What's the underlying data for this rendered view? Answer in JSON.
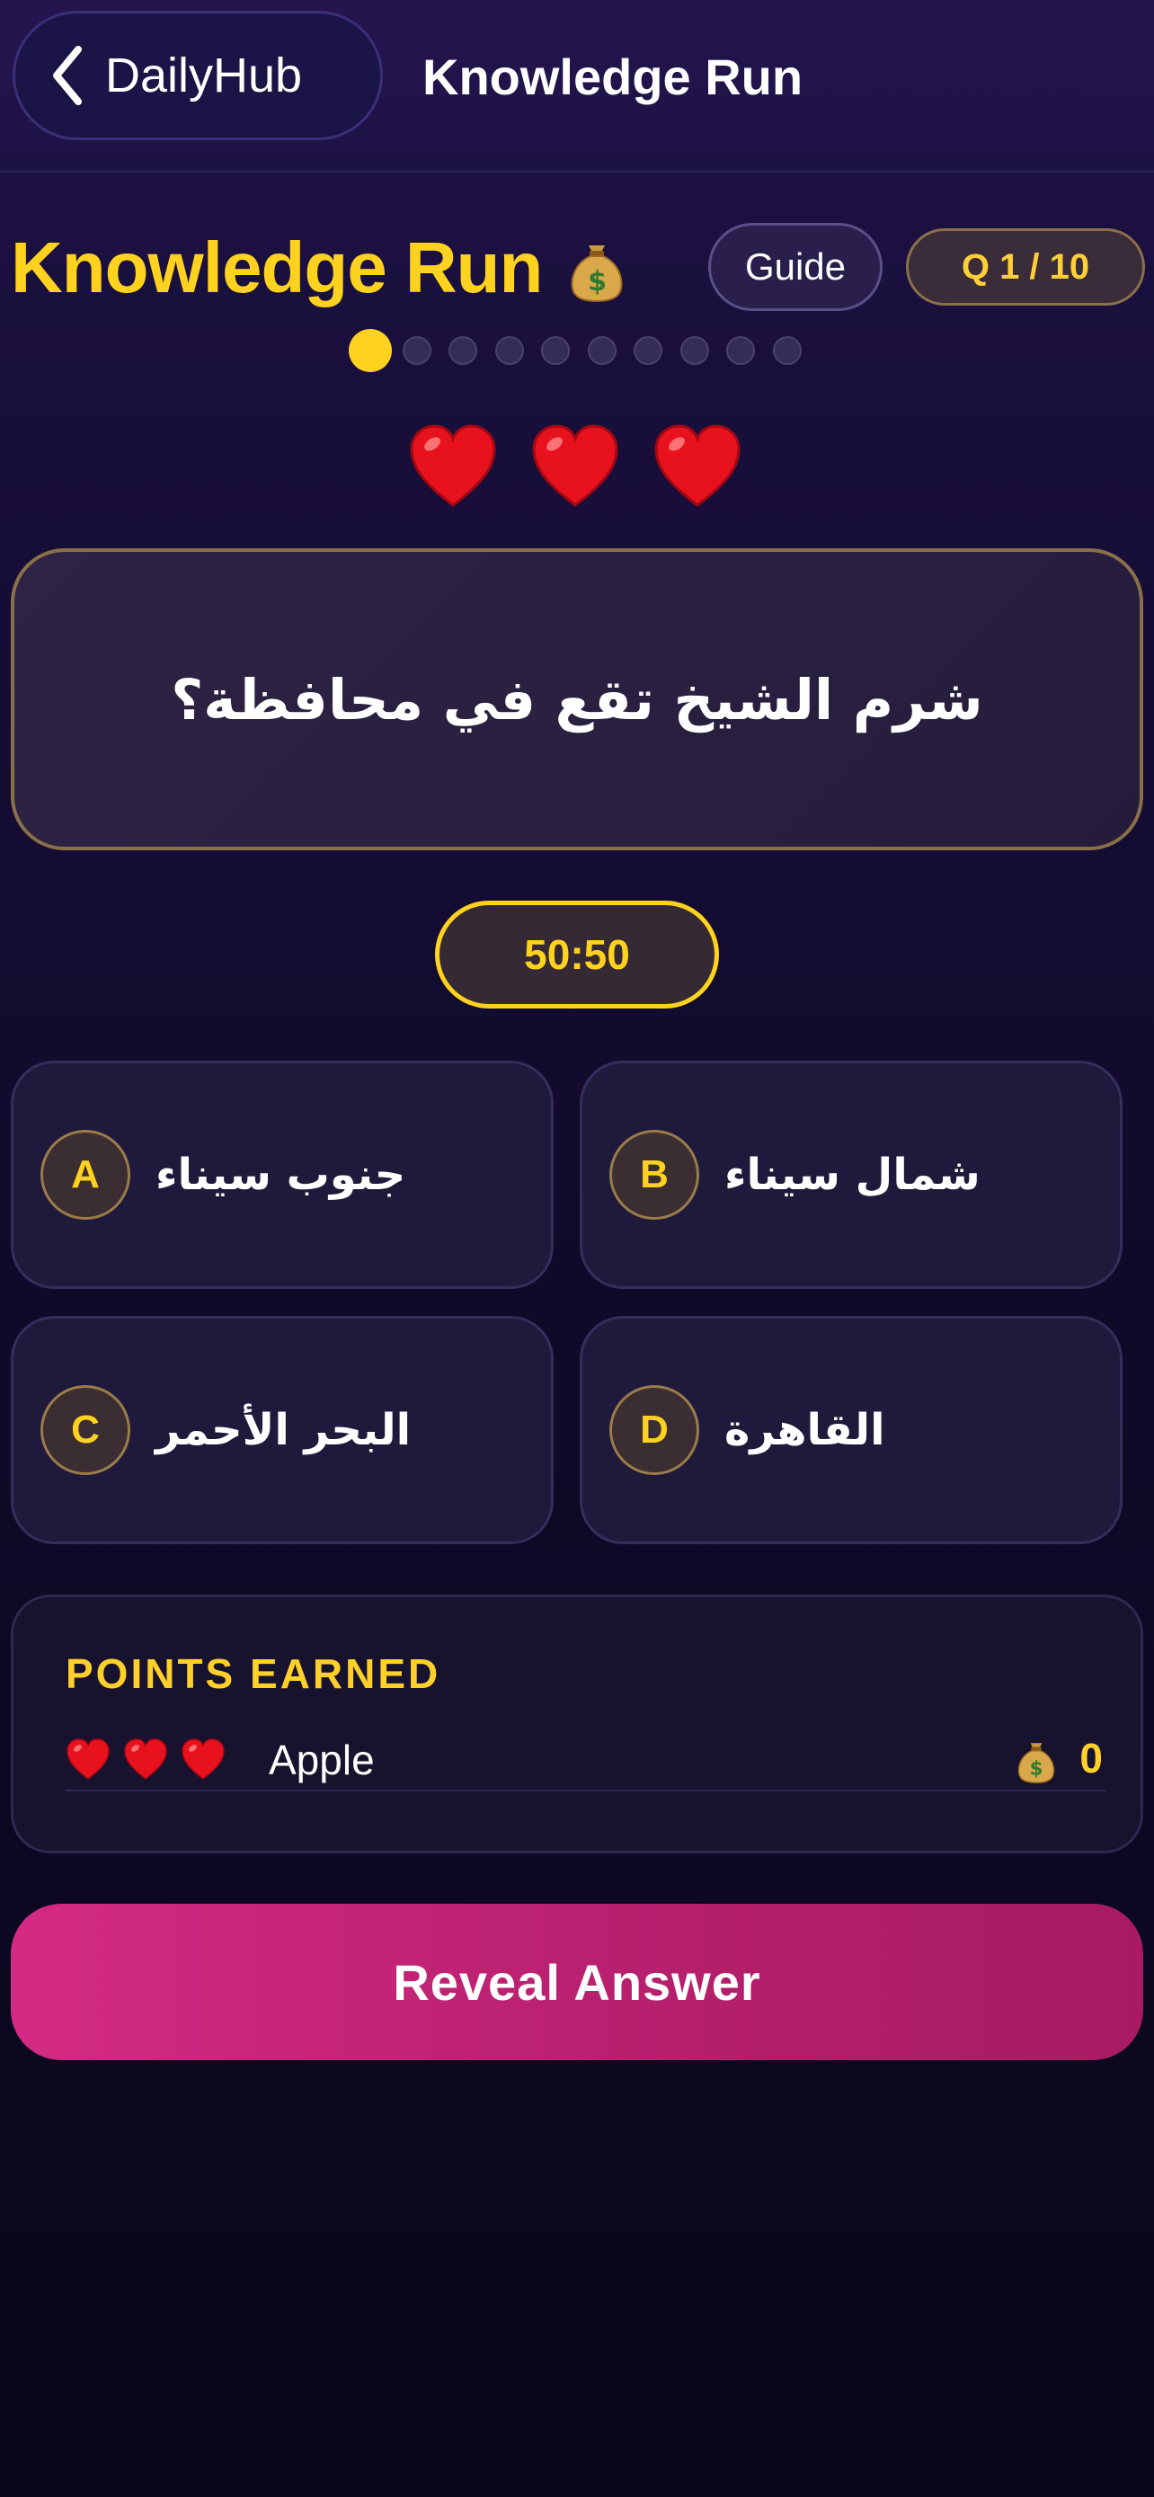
{
  "nav": {
    "back_label": "DailyHub",
    "title": "Knowledge Run"
  },
  "header": {
    "game_title": "Knowledge Run",
    "title_icon": "money-bag-icon",
    "guide_label": "Guide",
    "question_counter": "Q 1 / 10"
  },
  "progress": {
    "current": 1,
    "total": 10
  },
  "lives": {
    "count": 3,
    "icon": "heart-icon"
  },
  "question": {
    "text": "شرم الشيخ تقع في محافظة؟"
  },
  "lifeline": {
    "label": "50:50"
  },
  "answers": [
    {
      "letter": "A",
      "text": "جنوب سيناء"
    },
    {
      "letter": "B",
      "text": "شمال سيناء"
    },
    {
      "letter": "C",
      "text": "البحر الأحمر"
    },
    {
      "letter": "D",
      "text": "القاهرة"
    }
  ],
  "points": {
    "title": "POINTS EARNED",
    "player": {
      "name": "Apple",
      "lives": 3,
      "score": "0"
    }
  },
  "reveal_button": {
    "label": "Reveal Answer"
  },
  "colors": {
    "accent_yellow": "#ffd21f",
    "button_pink": "#d42a84",
    "background": "#160d36"
  }
}
